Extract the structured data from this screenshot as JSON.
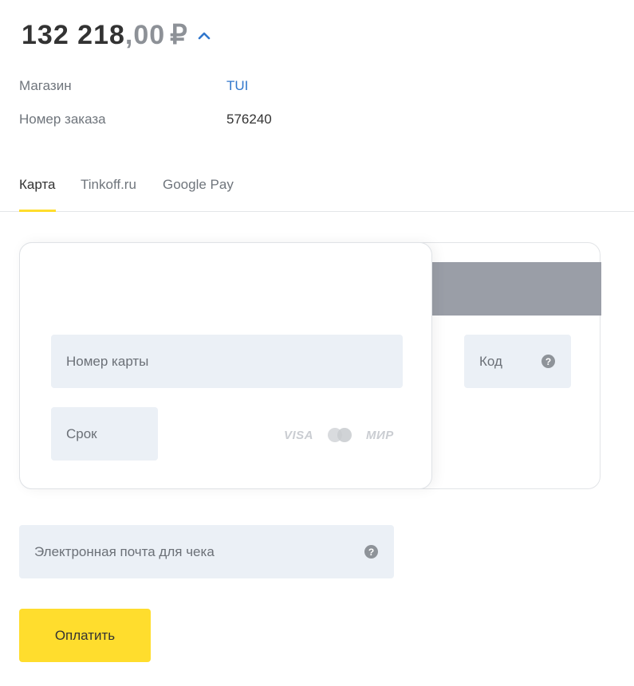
{
  "amount": {
    "integer": "132 218",
    "decimal": ",00",
    "currency": "₽"
  },
  "order_info": {
    "shop_label": "Магазин",
    "shop_value": "TUI",
    "order_label": "Номер заказа",
    "order_value": "576240"
  },
  "tabs": [
    {
      "label": "Карта",
      "active": true
    },
    {
      "label": "Tinkoff.ru",
      "active": false
    },
    {
      "label": "Google Pay",
      "active": false
    }
  ],
  "card_form": {
    "card_number_placeholder": "Номер карты",
    "expiry_placeholder": "Срок",
    "cvc_placeholder": "Код",
    "brand_logos": [
      "VISA",
      "mastercard",
      "МИР"
    ]
  },
  "email": {
    "placeholder": "Электронная почта для чека"
  },
  "pay_button": {
    "label": "Оплатить"
  },
  "icons": {
    "help": "?"
  },
  "colors": {
    "accent": "#ffdd2d",
    "link": "#3177cc",
    "field_bg": "#ebf0f6",
    "magstripe": "#9a9ea7"
  }
}
